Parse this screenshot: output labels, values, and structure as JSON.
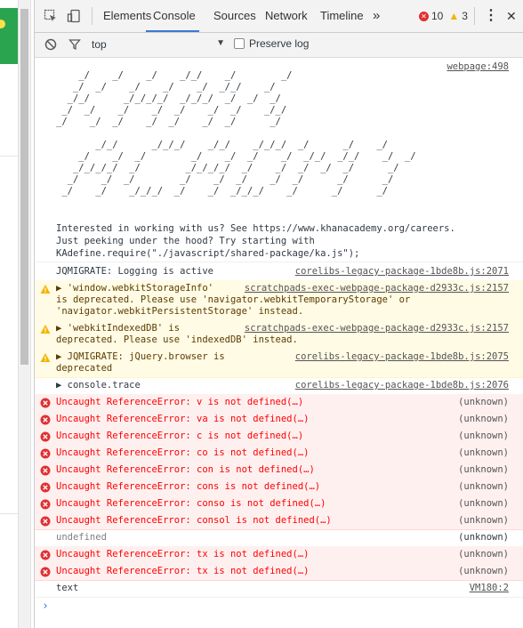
{
  "devtools": {
    "tabs": [
      {
        "label": "Elements"
      },
      {
        "label": "Console"
      },
      {
        "label": "Sources"
      },
      {
        "label": "Network"
      },
      {
        "label": "Timeline"
      }
    ],
    "more_tabs": "»",
    "error_count": "10",
    "warning_count": "3",
    "menu": "⋮",
    "close": "✕"
  },
  "filter": {
    "context": "top",
    "preserve_log_label": "Preserve log"
  },
  "colors": {
    "error": "#ff0000",
    "warning_bg": "#fffbe5",
    "error_bg": "#fff0f0",
    "accent": "#3879d9"
  },
  "console": {
    "banner_source": "webpage:498",
    "ascii_art": "    _/    _/    _/    _/_/    _/        _/\n   _/  _/    _/    _/    _/  _/_/    _/\n  _/_/      _/_/_/_/  _/_/_/  _/  _/  _/\n _/  _/    _/    _/  _/    _/  _/    _/_/\n_/    _/  _/    _/  _/    _/  _/      _/\n\n       _/_/      _/_/_/    _/_/    _/_/_/  _/      _/    _/\n    _/    _/  _/        _/    _/  _/    _/  _/_/  _/_/    _/  _/\n   _/_/_/_/  _/        _/_/_/_/  _/    _/  _/  _/  _/      _/\n  _/    _/  _/        _/    _/  _/    _/  _/      _/      _/\n _/    _/    _/_/_/  _/    _/  _/_/_/    _/      _/      _/",
    "intro_lines": [
      "Interested in working with us? See https://www.khanacademy.org/careers.",
      "Just peeking under the hood? Try starting with",
      "KAdefine.require(\"./javascript/shared-package/ka.js\");"
    ],
    "messages": [
      {
        "level": "log",
        "lines": [
          "JQMIGRATE: Logging is active"
        ],
        "source": "corelibs-legacy-package-1bde8b.js:2071"
      },
      {
        "level": "warn",
        "lines": [
          "▶ 'window.webkitStorageInfo'",
          "is deprecated. Please use 'navigator.webkitTemporaryStorage' or",
          "'navigator.webkitPersistentStorage' instead."
        ],
        "source": "scratchpads-exec-webpage-package-d2933c.js:2157"
      },
      {
        "level": "warn",
        "lines": [
          "▶ 'webkitIndexedDB' is",
          "deprecated. Please use 'indexedDB' instead."
        ],
        "source": "scratchpads-exec-webpage-package-d2933c.js:2157"
      },
      {
        "level": "warn",
        "lines": [
          "▶ JQMIGRATE: jQuery.browser is",
          "deprecated"
        ],
        "source": "corelibs-legacy-package-1bde8b.js:2075"
      },
      {
        "level": "log",
        "lines": [
          "▶ console.trace"
        ],
        "source": "corelibs-legacy-package-1bde8b.js:2076"
      },
      {
        "level": "error",
        "lines": [
          "Uncaught ReferenceError: v is not defined(…)"
        ],
        "source": "(unknown)"
      },
      {
        "level": "error",
        "lines": [
          "Uncaught ReferenceError: va is not defined(…)"
        ],
        "source": "(unknown)"
      },
      {
        "level": "error",
        "lines": [
          "Uncaught ReferenceError: c is not defined(…)"
        ],
        "source": "(unknown)"
      },
      {
        "level": "error",
        "lines": [
          "Uncaught ReferenceError: co is not defined(…)"
        ],
        "source": "(unknown)"
      },
      {
        "level": "error",
        "lines": [
          "Uncaught ReferenceError: con is not defined(…)"
        ],
        "source": "(unknown)"
      },
      {
        "level": "error",
        "lines": [
          "Uncaught ReferenceError: cons is not defined(…)"
        ],
        "source": "(unknown)"
      },
      {
        "level": "error",
        "lines": [
          "Uncaught ReferenceError: conso is not defined(…)"
        ],
        "source": "(unknown)"
      },
      {
        "level": "error",
        "lines": [
          "Uncaught ReferenceError: consol is not defined(…)"
        ],
        "source": "(unknown)"
      },
      {
        "level": "result",
        "lines": [
          "undefined"
        ],
        "source": "(unknown)"
      },
      {
        "level": "error",
        "lines": [
          "Uncaught ReferenceError: tx is not defined(…)"
        ],
        "source": "(unknown)"
      },
      {
        "level": "error",
        "lines": [
          "Uncaught ReferenceError: tx is not defined(…)"
        ],
        "source": "(unknown)"
      },
      {
        "level": "log",
        "lines": [
          "text"
        ],
        "source": "VM180:2"
      }
    ],
    "prompt": "›"
  }
}
